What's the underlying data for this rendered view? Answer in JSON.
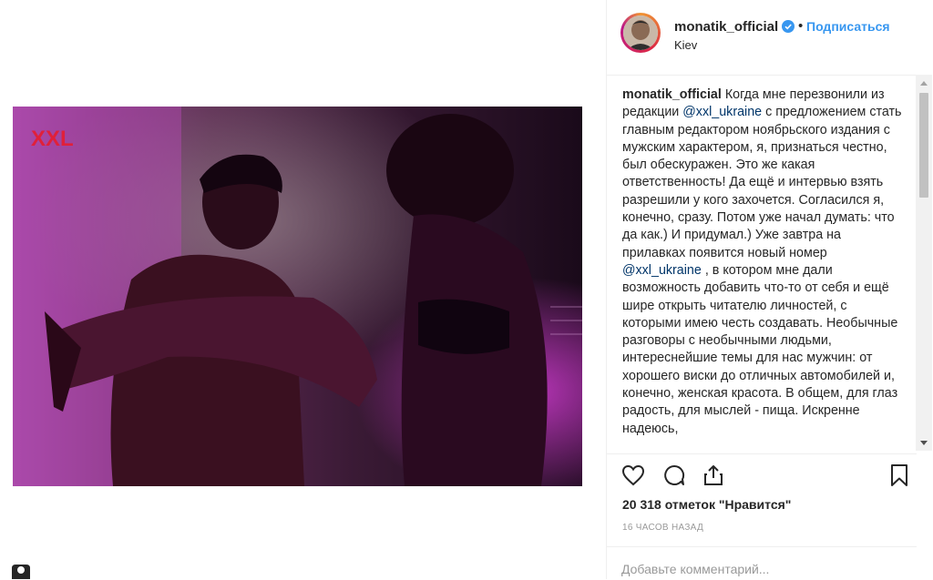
{
  "post": {
    "username": "monatik_official",
    "follow_label": "Подписаться",
    "dot": "•",
    "location": "Kiev",
    "image_logo": "XXL",
    "caption": {
      "user": "monatik_official",
      "part1": " Когда мне перезвонили из редакции ",
      "mention1": "@xxl_ukraine",
      "part2": " с предложением стать главным редактором ноябрьского издания с мужским характером, я, признаться честно, был обескуражен. Это же какая ответственность! Да ещё и интервью взять разрешили у кого захочется. Согласился я, конечно, сразу. Потом уже начал думать: что да как.) И придумал.) Уже завтра на прилавках появится новый номер ",
      "mention2": "@xxl_ukraine",
      "part3": " , в котором мне дали возможность добавить что-то от себя и ещё шире открыть читателю личностей, с которыми имею честь создавать. Необычные разговоры с необычными людьми, интереснейшие темы для нас мужчин: от хорошего виски до отличных автомобилей и, конечно, женская красота. В общем, для глаз радость, для мыслей - пища. Искренне надеюсь,"
    },
    "likes": "20 318 отметок \"Нравится\"",
    "time_ago": "16 ЧАСОВ НАЗАД",
    "comment_placeholder": "Добавьте комментарий..."
  },
  "icons": {
    "like": "heart-icon",
    "comment": "comment-icon",
    "share": "share-icon",
    "save": "bookmark-icon",
    "verified": "verified-badge-icon"
  },
  "colors": {
    "link": "#3897f0",
    "mention": "#003569",
    "logo": "#e0203a",
    "verified": "#3897f0"
  }
}
